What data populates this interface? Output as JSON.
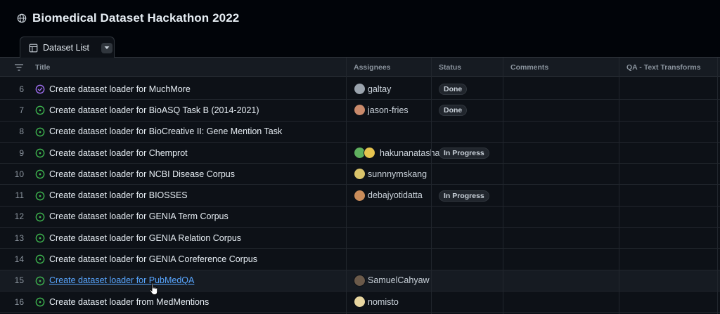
{
  "project": {
    "title": "Biomedical Dataset Hackathon 2022",
    "icon": "globe-icon"
  },
  "view": {
    "tab_label": "Dataset List",
    "tab_icon": "table-icon",
    "menu_icon": "triangle-down-icon"
  },
  "columns": [
    "Title",
    "Assignees",
    "Status",
    "Comments",
    "QA - Text Transforms"
  ],
  "colors": {
    "background": "#0d1117",
    "open_issue": "#3fb950",
    "closed_issue": "#a371f7",
    "link": "#58a6ff"
  },
  "rows": [
    {
      "num": "6",
      "state": "closed",
      "title": "Create dataset loader for MuchMore",
      "assignees": [
        {
          "name": "galtay",
          "avatars": [
            "#9aa3ad"
          ]
        }
      ],
      "status": "Done"
    },
    {
      "num": "7",
      "state": "open",
      "title": "Create dataset loader for BioASQ Task B (2014-2021)",
      "assignees": [
        {
          "name": "jason-fries",
          "avatars": [
            "#c98a6b"
          ]
        }
      ],
      "status": "Done"
    },
    {
      "num": "8",
      "state": "open",
      "title": "Create dataset loader for BioCreative II: Gene Mention Task",
      "assignees": [],
      "status": ""
    },
    {
      "num": "9",
      "state": "open",
      "title": "Create dataset loader for Chemprot",
      "assignees": [
        {
          "name": "hakunanatasha",
          "avatars": [
            "#5fb05f",
            "#e6c44f"
          ]
        }
      ],
      "status": "In Progress"
    },
    {
      "num": "10",
      "state": "open",
      "title": "Create dataset loader for NCBI Disease Corpus",
      "assignees": [
        {
          "name": "sunnnymskang",
          "avatars": [
            "#d9c36a"
          ]
        }
      ],
      "status": ""
    },
    {
      "num": "11",
      "state": "open",
      "title": "Create dataset loader for BIOSSES",
      "assignees": [
        {
          "name": "debajyotidatta",
          "avatars": [
            "#c98c5a"
          ]
        }
      ],
      "status": "In Progress"
    },
    {
      "num": "12",
      "state": "open",
      "title": "Create dataset loader for GENIA Term Corpus",
      "assignees": [],
      "status": ""
    },
    {
      "num": "13",
      "state": "open",
      "title": "Create dataset loader for GENIA Relation Corpus",
      "assignees": [],
      "status": ""
    },
    {
      "num": "14",
      "state": "open",
      "title": "Create dataset loader for GENIA Coreference Corpus",
      "assignees": [],
      "status": ""
    },
    {
      "num": "15",
      "state": "open",
      "title": "Create dataset loader for PubMedQA",
      "assignees": [
        {
          "name": "SamuelCahyaw",
          "avatars": [
            "#6b5a4a"
          ]
        }
      ],
      "status": "",
      "hovered": true
    },
    {
      "num": "16",
      "state": "open",
      "title": "Create dataset loader from MedMentions",
      "assignees": [
        {
          "name": "nomisto",
          "avatars": [
            "#e8d6a0"
          ]
        }
      ],
      "status": ""
    }
  ]
}
